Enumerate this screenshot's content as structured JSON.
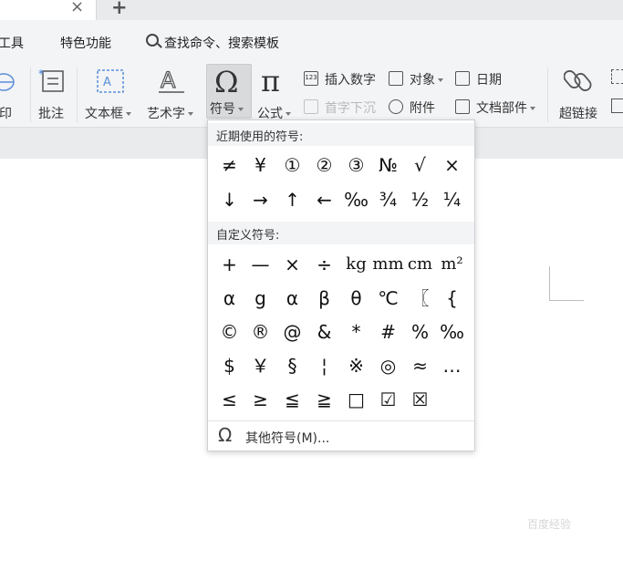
{
  "tabs": {
    "close_icon": "×",
    "new_tab_icon": "+"
  },
  "menu": {
    "items": [
      "工具",
      "特色功能"
    ],
    "search_label": "查找命令、搜索模板"
  },
  "ribbon": {
    "print_partial": "印",
    "comment": "批注",
    "textbox": "文本框",
    "art_text": "艺术字",
    "symbol": "符号",
    "formula": "公式",
    "insert_number": "插入数字",
    "object": "对象",
    "date": "日期",
    "drop_cap": "首字下沉",
    "attachment": "附件",
    "doc_parts": "文档部件",
    "hyperlink": "超链接"
  },
  "symbol_popup": {
    "recent_title": "近期使用的符号:",
    "recent_symbols": [
      [
        "≠",
        "¥",
        "①",
        "②",
        "③",
        "№",
        "√",
        "×"
      ],
      [
        "↓",
        "→",
        "↑",
        "←",
        "‰",
        "¾",
        "½",
        "¼"
      ]
    ],
    "custom_title": "自定义符号:",
    "custom_symbols": [
      [
        "+",
        "—",
        "×",
        "÷",
        "kg",
        "mm",
        "cm",
        "m²"
      ],
      [
        "α",
        "g",
        "α",
        "β",
        "θ",
        "℃",
        "〖",
        "{"
      ],
      [
        "©",
        "®",
        "@",
        "&",
        "*",
        "#",
        "%",
        "‰"
      ],
      [
        "$",
        "￥",
        "§",
        "¦",
        "※",
        "◎",
        "≈",
        "…"
      ],
      [
        "≤",
        "≥",
        "≦",
        "≧",
        "□",
        "☑",
        "☒"
      ]
    ],
    "more_label": "其他符号(M)..."
  },
  "watermark": "百度经验"
}
